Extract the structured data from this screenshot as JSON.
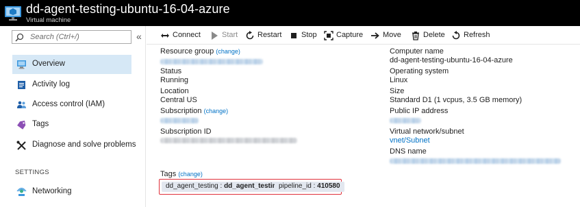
{
  "header": {
    "title": "dd-agent-testing-ubuntu-16-04-azure",
    "subtitle": "Virtual machine"
  },
  "sidebar": {
    "search_placeholder": "Search (Ctrl+/)",
    "collapse_glyph": "«",
    "items": [
      {
        "label": "Overview",
        "icon": "monitor-icon",
        "active": true
      },
      {
        "label": "Activity log",
        "icon": "activity-log-icon"
      },
      {
        "label": "Access control (IAM)",
        "icon": "people-icon"
      },
      {
        "label": "Tags",
        "icon": "tag-icon"
      },
      {
        "label": "Diagnose and solve problems",
        "icon": "wrench-icon"
      }
    ],
    "section_settings": "SETTINGS",
    "settings_items": [
      {
        "label": "Networking",
        "icon": "network-icon"
      }
    ]
  },
  "toolbar": {
    "connect": "Connect",
    "start": "Start",
    "restart": "Restart",
    "stop": "Stop",
    "capture": "Capture",
    "move": "Move",
    "delete": "Delete",
    "refresh": "Refresh"
  },
  "essentials": {
    "change_text": "(change)",
    "resource_group_label": "Resource group",
    "status_label": "Status",
    "status_value": "Running",
    "location_label": "Location",
    "location_value": "Central US",
    "subscription_label": "Subscription",
    "subscription_id_label": "Subscription ID",
    "computer_name_label": "Computer name",
    "computer_name_value": "dd-agent-testing-ubuntu-16-04-azure",
    "os_label": "Operating system",
    "os_value": "Linux",
    "size_label": "Size",
    "size_value": "Standard D1 (1 vcpus, 3.5 GB memory)",
    "public_ip_label": "Public IP address",
    "vnet_label": "Virtual network/subnet",
    "vnet_value": "vnet/Subnet",
    "dns_label": "DNS name"
  },
  "tags": {
    "label": "Tags",
    "change_text": "(change)",
    "items": [
      {
        "key": "dd_agent_testing",
        "value": "dd_agent_testing"
      },
      {
        "key": "pipeline_id",
        "value": "410580"
      }
    ],
    "highlight_color": "#e0303a"
  },
  "colors": {
    "header_bg": "#000000",
    "link": "#0072c6",
    "active_nav_bg": "#d6e8f6",
    "tag_bg": "#e2e7ef"
  }
}
